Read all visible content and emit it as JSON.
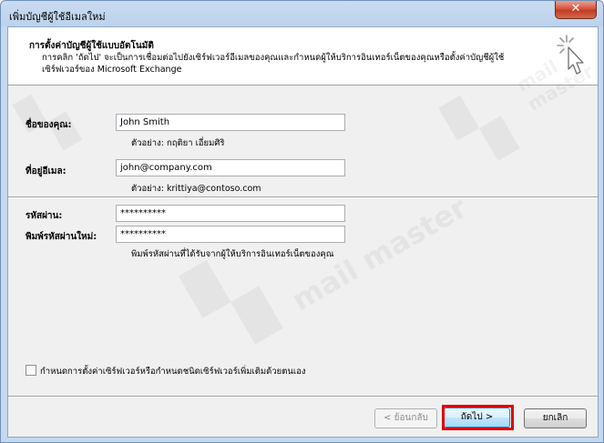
{
  "window": {
    "title": "เพิ่มบัญชีผู้ใช้อีเมลใหม่",
    "close_label": "✕"
  },
  "header": {
    "title": "การตั้งค่าบัญชีผู้ใช้แบบอัตโนมัติ",
    "description": "การคลิก 'ถัดไป' จะเป็นการเชื่อมต่อไปยังเซิร์ฟเวอร์อีเมลของคุณและกำหนดผู้ให้บริการอินเทอร์เน็ตของคุณหรือตั้งค่าบัญชีผู้ใช้เซิร์ฟเวอร์ของ Microsoft Exchange",
    "icon": "wizard-cursor-icon"
  },
  "form": {
    "name_label": "ชื่อของคุณ:",
    "name_value": "John Smith",
    "name_hint": "ตัวอย่าง: กฤติยา เอี่ยมศิริ",
    "email_label": "ที่อยู่อีเมล:",
    "email_value": "john@company.com",
    "email_hint": "ตัวอย่าง: krittiya@contoso.com",
    "password_label": "รหัสผ่าน:",
    "password_value": "**********",
    "retype_label": "พิมพ์รหัสผ่านใหม่:",
    "retype_value": "**********",
    "password_hint": "พิมพ์รหัสผ่านที่ได้รับจากผู้ให้บริการอินเทอร์เน็ตของคุณ"
  },
  "manual_setup": {
    "label": "กำหนดการตั้งค่าเซิร์ฟเวอร์หรือกำหนดชนิดเซิร์ฟเวอร์เพิ่มเติมด้วยตนเอง",
    "checked": false
  },
  "buttons": {
    "back_label": "< ย้อนกลับ",
    "next_label": "ถัดไป >",
    "cancel_label": "ยกเลิก"
  },
  "watermark": {
    "text": "mail master"
  },
  "colors": {
    "highlight": "#e00000",
    "close_button": "#c23a20"
  }
}
